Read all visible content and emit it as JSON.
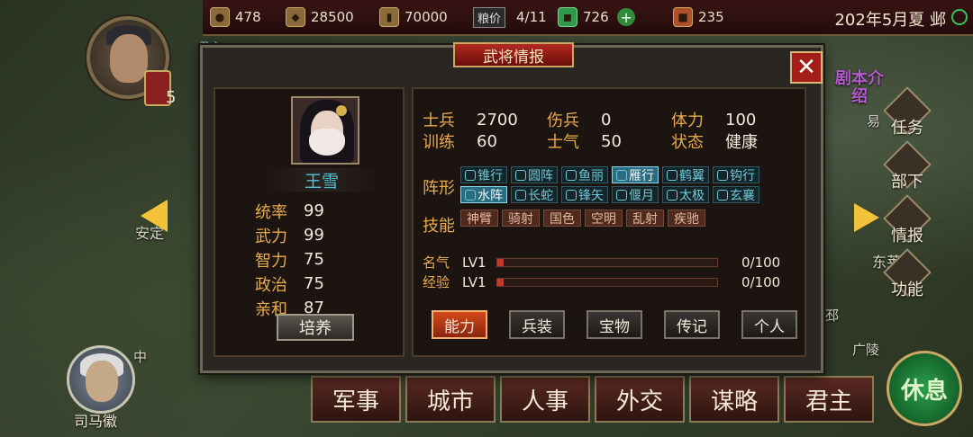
{
  "topbar": {
    "resources": [
      {
        "icon": "coin-icon",
        "value": "478"
      },
      {
        "icon": "money-bag-icon",
        "value": "28500"
      },
      {
        "icon": "wood-icon",
        "value": "70000"
      }
    ],
    "food_label": "粮价",
    "food_value": "4/11",
    "gem_value": "726",
    "plus": "+",
    "book_value": "235",
    "date": "202年5月夏 邺"
  },
  "map_labels": {
    "left_city": "安定",
    "right_city": "东莱",
    "yi": "易",
    "guangling": "广陵",
    "zhong": "中",
    "pi": "邳",
    "lord_prefix": "君主:"
  },
  "lord": {
    "level": "5"
  },
  "npc": {
    "name": "司马徽"
  },
  "side_menu": {
    "script": "剧本介绍",
    "items": [
      "任务",
      "部下",
      "情报",
      "功能"
    ]
  },
  "bottom_menu": [
    "军事",
    "城市",
    "人事",
    "外交",
    "谋略",
    "君主"
  ],
  "rest_label": "休息",
  "dialog": {
    "title": "武将情报",
    "close": "✕",
    "general": {
      "name": "王雪",
      "stats": [
        {
          "k": "统率",
          "v": "99"
        },
        {
          "k": "武力",
          "v": "99"
        },
        {
          "k": "智力",
          "v": "75"
        },
        {
          "k": "政治",
          "v": "75"
        },
        {
          "k": "亲和",
          "v": "87"
        }
      ],
      "train_button": "培养"
    },
    "info": {
      "row1": [
        {
          "k": "士兵",
          "v": "2700"
        },
        {
          "k": "伤兵",
          "v": "0"
        },
        {
          "k": "体力",
          "v": "100"
        }
      ],
      "row2": [
        {
          "k": "训练",
          "v": "60"
        },
        {
          "k": "士气",
          "v": "50"
        },
        {
          "k": "状态",
          "v": "健康"
        }
      ]
    },
    "formation_label": "阵形",
    "formations": [
      "锥行",
      "圆阵",
      "鱼丽",
      "雁行",
      "鹤翼",
      "钩行",
      "水阵",
      "长蛇",
      "锋矢",
      "偃月",
      "太极",
      "玄襄"
    ],
    "formations_selected": [
      "雁行",
      "水阵"
    ],
    "skill_label": "技能",
    "skills": [
      "神臂",
      "骑射",
      "国色",
      "空明",
      "乱射",
      "疾驰"
    ],
    "fame": {
      "label": "名气",
      "lv": "LV1",
      "value": "0/100",
      "progress": 0.03
    },
    "exp": {
      "label": "经验",
      "lv": "LV1",
      "value": "0/100",
      "progress": 0.03
    },
    "tabs": [
      "能力",
      "兵装",
      "宝物",
      "传记",
      "个人"
    ],
    "active_tab": "能力"
  }
}
